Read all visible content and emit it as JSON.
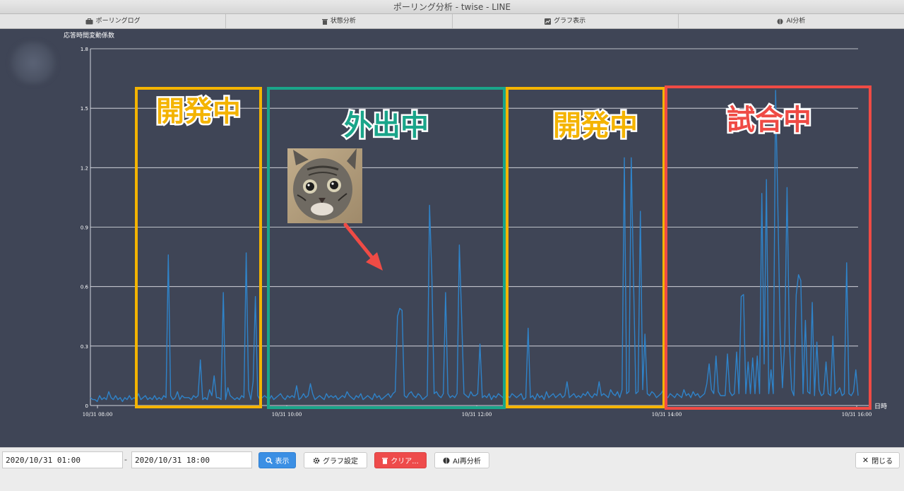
{
  "window": {
    "title": "ポーリング分析 - twise - LINE"
  },
  "tabs": [
    {
      "label": "ポーリングログ",
      "icon": "briefcase-icon"
    },
    {
      "label": "状態分析",
      "icon": "trash-icon"
    },
    {
      "label": "グラフ表示",
      "icon": "chart-icon"
    },
    {
      "label": "AI分析",
      "icon": "brain-icon"
    }
  ],
  "chart_data": {
    "type": "line",
    "ylabel": "応答時間変動係数",
    "xlabel": "日時",
    "ylim": [
      0,
      1.8
    ],
    "yticks": [
      "1.8",
      "1.5",
      "1.2",
      "0.9",
      "0.6",
      "0.3",
      "0"
    ],
    "xticks": [
      "10/31 08:00",
      "10/31 10:00",
      "10/31 12:00",
      "10/31 14:00",
      "10/31 16:00"
    ],
    "grid": true,
    "color": "#2f83c9",
    "series": [
      {
        "x_range": [
          "10/31 08:00",
          "10/31 16:14"
        ],
        "values": [
          0.04,
          0.03,
          0.03,
          0.02,
          0.05,
          0.03,
          0.04,
          0.03,
          0.07,
          0.04,
          0.03,
          0.05,
          0.03,
          0.04,
          0.02,
          0.04,
          0.03,
          0.05,
          0.03,
          0.04,
          0.03,
          0.06,
          0.03,
          0.04,
          0.05,
          0.03,
          0.04,
          0.03,
          0.05,
          0.03,
          0.04,
          0.03,
          0.05,
          0.04,
          0.76,
          0.05,
          0.03,
          0.04,
          0.07,
          0.03,
          0.05,
          0.04,
          0.04,
          0.04,
          0.03,
          0.05,
          0.04,
          0.05,
          0.23,
          0.03,
          0.04,
          0.03,
          0.08,
          0.05,
          0.15,
          0.04,
          0.04,
          0.03,
          0.57,
          0.03,
          0.09,
          0.05,
          0.04,
          0.03,
          0.04,
          0.03,
          0.05,
          0.04,
          0.77,
          0.08,
          0.03,
          0.12,
          0.55,
          0.05,
          0.03,
          0.04,
          0.05,
          0.04,
          0.03,
          0.05,
          0.03,
          0.04,
          0.05,
          0.06,
          0.04,
          0.03,
          0.05,
          0.04,
          0.05,
          0.04,
          0.1,
          0.03,
          0.04,
          0.06,
          0.04,
          0.05,
          0.11,
          0.06,
          0.03,
          0.04,
          0.05,
          0.04,
          0.03,
          0.06,
          0.04,
          0.05,
          0.04,
          0.05,
          0.03,
          0.04,
          0.05,
          0.04,
          0.07,
          0.05,
          0.04,
          0.03,
          0.05,
          0.04,
          0.06,
          0.03,
          0.04,
          0.05,
          0.04,
          0.03,
          0.06,
          0.04,
          0.05,
          0.03,
          0.04,
          0.05,
          0.06,
          0.04,
          0.06,
          0.07,
          0.45,
          0.49,
          0.48,
          0.05,
          0.04,
          0.06,
          0.07,
          0.05,
          0.04,
          0.06,
          0.05,
          0.03,
          0.04,
          0.05,
          1.01,
          0.65,
          0.06,
          0.07,
          0.05,
          0.04,
          0.06,
          0.57,
          0.06,
          0.04,
          0.05,
          0.04,
          0.06,
          0.81,
          0.44,
          0.06,
          0.05,
          0.04,
          0.07,
          0.05,
          0.05,
          0.06,
          0.31,
          0.04,
          0.05,
          0.04,
          0.06,
          0.03,
          0.05,
          0.04,
          0.06,
          0.05,
          0.04,
          0.06,
          0.05,
          0.04,
          0.06,
          0.05,
          0.04,
          0.05,
          0.06,
          0.03,
          0.04,
          0.39,
          0.04,
          0.05,
          0.03,
          0.06,
          0.04,
          0.05,
          0.03,
          0.07,
          0.04,
          0.05,
          0.06,
          0.04,
          0.05,
          0.06,
          0.04,
          0.05,
          0.12,
          0.04,
          0.05,
          0.06,
          0.04,
          0.05,
          0.04,
          0.06,
          0.05,
          0.07,
          0.05,
          0.04,
          0.06,
          0.05,
          0.12,
          0.05,
          0.06,
          0.05,
          0.04,
          0.08,
          0.06,
          0.05,
          0.07,
          0.04,
          0.08,
          1.25,
          0.06,
          0.07,
          1.25,
          0.64,
          0.06,
          0.07,
          0.98,
          0.08,
          0.36,
          0.06,
          0.05,
          0.07,
          0.06,
          0.04,
          0.05,
          0.06,
          0.08,
          0.05,
          0.04,
          0.06,
          0.05,
          0.04,
          0.06,
          0.05,
          0.04,
          0.08,
          0.05,
          0.06,
          0.04,
          0.07,
          0.05,
          0.06,
          0.04,
          0.05,
          0.06,
          0.11,
          0.21,
          0.08,
          0.06,
          0.25,
          0.07,
          0.05,
          0.05,
          0.05,
          0.26,
          0.07,
          0.05,
          0.06,
          0.27,
          0.06,
          0.55,
          0.56,
          0.06,
          0.22,
          0.06,
          0.24,
          0.06,
          0.25,
          0.06,
          1.07,
          0.21,
          1.14,
          0.06,
          0.18,
          0.06,
          1.59,
          1.0,
          0.35,
          0.09,
          0.33,
          1.1,
          0.32,
          0.08,
          0.05,
          0.56,
          0.66,
          0.63,
          0.06,
          0.43,
          0.07,
          0.06,
          0.52,
          0.05,
          0.32,
          0.08,
          0.05,
          0.06,
          0.22,
          0.06,
          0.05,
          0.35,
          0.06,
          0.07,
          0.09,
          0.05,
          0.06,
          0.72,
          0.06,
          0.05,
          0.07,
          0.18,
          0.05
        ]
      }
    ]
  },
  "annotations": [
    {
      "label": "開発中",
      "color": "#f4b400"
    },
    {
      "label": "外出中",
      "color": "#1aa58a"
    },
    {
      "label": "開発中",
      "color": "#f4b400"
    },
    {
      "label": "試合中",
      "color": "#ef4b45"
    }
  ],
  "cat_photo": {
    "icon": "cat-photo-icon"
  },
  "controls": {
    "start_date": "2020/10/31 01:00",
    "separator": "-",
    "end_date": "2020/10/31 18:00",
    "show_label": "表示",
    "graph_settings_label": "グラフ設定",
    "clear_label": "クリア...",
    "ai_reanalyze_label": "AI再分析",
    "close_label": "閉じる"
  }
}
